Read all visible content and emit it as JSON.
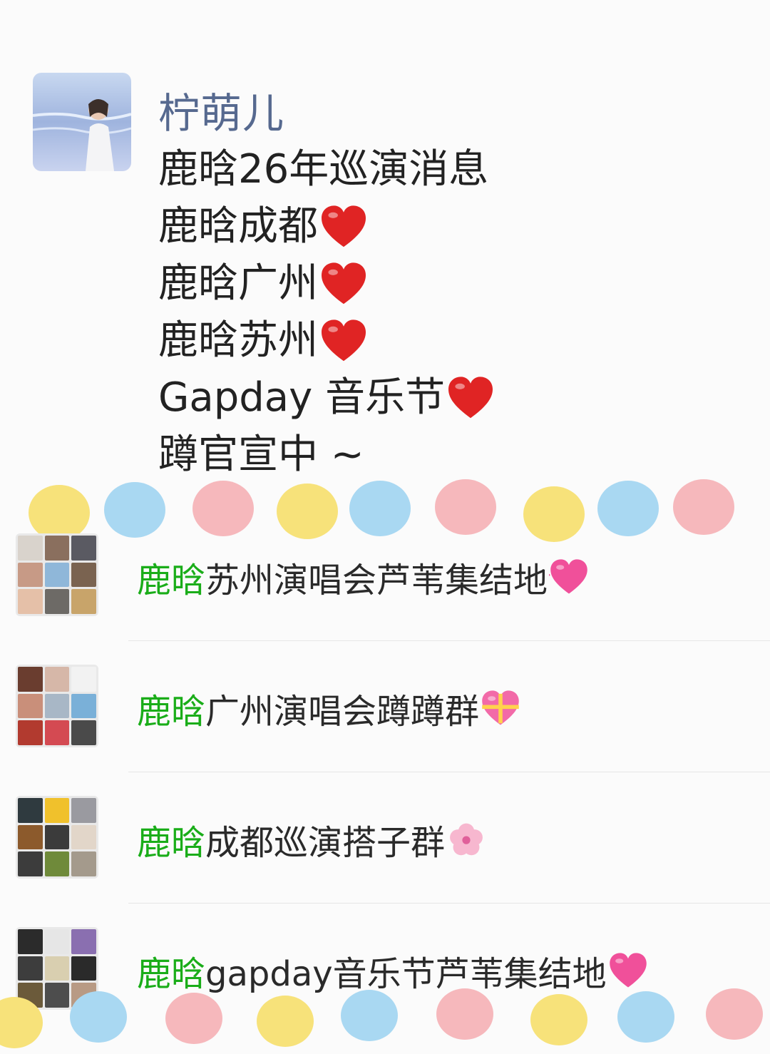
{
  "post": {
    "author": "柠萌儿",
    "lines": [
      {
        "text": "鹿晗26年巡演消息",
        "emoji": ""
      },
      {
        "text": "鹿晗成都",
        "emoji": "red-heart"
      },
      {
        "text": "鹿晗广州",
        "emoji": "red-heart"
      },
      {
        "text": "鹿晗苏州",
        "emoji": "red-heart"
      },
      {
        "text": "Gapday 音乐节",
        "emoji": "red-heart"
      },
      {
        "text": "蹲官宣中 ~",
        "emoji": ""
      }
    ]
  },
  "groups": [
    {
      "highlight": "鹿晗",
      "rest": "苏州演唱会芦苇集结地",
      "emoji": "vibrating-heart"
    },
    {
      "highlight": "鹿晗",
      "rest": "广州演唱会蹲蹲群",
      "emoji": "heart-with-ribbon"
    },
    {
      "highlight": "鹿晗",
      "rest": "成都巡演搭子群",
      "emoji": "cherry-blossom"
    },
    {
      "highlight": "鹿晗",
      "rest": "gapday音乐节芦苇集结地",
      "emoji": "growing-heart"
    }
  ],
  "colors": {
    "author": "#56698f",
    "highlight": "#1aad19",
    "dot_yellow": "#f7e27a",
    "dot_blue": "#a9d8f2",
    "dot_pink": "#f6b8bc"
  }
}
